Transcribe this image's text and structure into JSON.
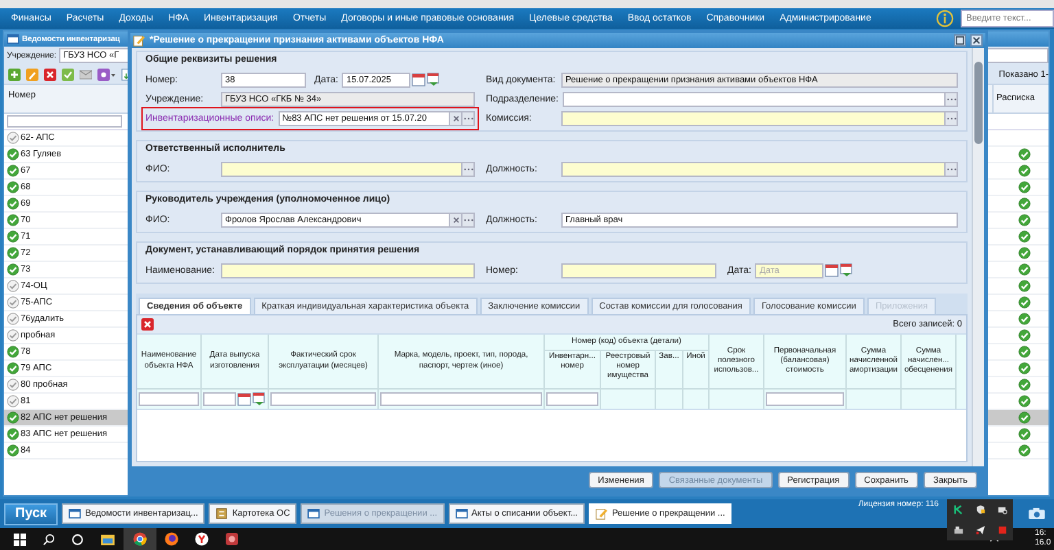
{
  "menu": [
    "Финансы",
    "Расчеты",
    "Доходы",
    "НФА",
    "Инвентаризация",
    "Отчеты",
    "Договоры и иные правовые основания",
    "Целевые средства",
    "Ввод остатков",
    "Справочники",
    "Администрирование"
  ],
  "search": {
    "placeholder": "Введите текст..."
  },
  "list_window": {
    "title": "Ведомости инвентаризац",
    "institution": {
      "label": "Учреждение:",
      "value": "ГБУЗ НСО «Г"
    },
    "shown": "Показано 1-",
    "columns": [
      "Номер",
      "Расписка"
    ],
    "rows": [
      {
        "number": "62- АПС",
        "done": false,
        "receipt": false,
        "selected": false
      },
      {
        "number": "63 Гуляев",
        "done": true,
        "receipt": true,
        "selected": false
      },
      {
        "number": "67",
        "done": true,
        "receipt": true,
        "selected": false
      },
      {
        "number": "68",
        "done": true,
        "receipt": true,
        "selected": false
      },
      {
        "number": "69",
        "done": true,
        "receipt": true,
        "selected": false
      },
      {
        "number": "70",
        "done": true,
        "receipt": true,
        "selected": false
      },
      {
        "number": "71",
        "done": true,
        "receipt": true,
        "selected": false
      },
      {
        "number": "72",
        "done": true,
        "receipt": true,
        "selected": false
      },
      {
        "number": "73",
        "done": true,
        "receipt": true,
        "selected": false
      },
      {
        "number": "74-ОЦ",
        "done": false,
        "receipt": true,
        "selected": false
      },
      {
        "number": "75-АПС",
        "done": false,
        "receipt": true,
        "selected": false
      },
      {
        "number": "76удалить",
        "done": false,
        "receipt": true,
        "selected": false
      },
      {
        "number": "пробная",
        "done": false,
        "receipt": true,
        "selected": false
      },
      {
        "number": "78",
        "done": true,
        "receipt": true,
        "selected": false
      },
      {
        "number": "79 АПС",
        "done": true,
        "receipt": true,
        "selected": false
      },
      {
        "number": "80 пробная",
        "done": false,
        "receipt": true,
        "selected": false
      },
      {
        "number": "81",
        "done": false,
        "receipt": true,
        "selected": false
      },
      {
        "number": "82 АПС нет решения",
        "done": true,
        "receipt": true,
        "selected": true
      },
      {
        "number": "83 АПС нет решения",
        "done": true,
        "receipt": true,
        "selected": false
      },
      {
        "number": "84",
        "done": true,
        "receipt": true,
        "selected": false
      }
    ]
  },
  "dialog": {
    "title": "*Решение о прекращении признания активами объектов НФА",
    "sections": [
      {
        "title": "Общие реквизиты решения",
        "rows": [
          {
            "left": [
              {
                "label": "Номер:",
                "value": "38",
                "kind": "text"
              },
              {
                "label": "Дата:",
                "value": "15.07.2025",
                "kind": "text",
                "calendar": true
              }
            ],
            "right": [
              {
                "label": "Вид документа:",
                "value": "Решение о прекращении признания активами объектов НФА",
                "kind": "readonly"
              }
            ]
          },
          {
            "left": [
              {
                "label": "Учреждение:",
                "value": "ГБУЗ НСО «ГКБ № 34»",
                "kind": "readonly"
              }
            ],
            "right": [
              {
                "label": "Подразделение:",
                "kind": "text",
                "picker": true
              }
            ]
          },
          {
            "left": [
              {
                "label": "Инвентаризационные описи:",
                "value": "№83 АПС нет решения от 15.07.20",
                "kind": "text",
                "clear": true,
                "picker": true,
                "link": true,
                "highlight": true
              }
            ],
            "right": [
              {
                "label": "Комиссия:",
                "kind": "required",
                "picker": true
              }
            ]
          }
        ]
      },
      {
        "title": "Ответственный исполнитель",
        "rows": [
          {
            "left": [
              {
                "label": "ФИО:",
                "kind": "required",
                "picker": true
              }
            ],
            "right": [
              {
                "label": "Должность:",
                "kind": "required",
                "picker": true
              }
            ]
          }
        ]
      },
      {
        "title": "Руководитель учреждения (уполномоченное лицо)",
        "rows": [
          {
            "left": [
              {
                "label": "ФИО:",
                "value": "Фролов Ярослав Александрович",
                "kind": "text",
                "clear": true,
                "picker": true
              }
            ],
            "right": [
              {
                "label": "Должность:",
                "value": "Главный врач",
                "kind": "text"
              }
            ]
          }
        ]
      },
      {
        "title": "Документ, устанавливающий порядок принятия решения",
        "rows": [
          {
            "left": [
              {
                "label": "Наименование:",
                "kind": "required"
              }
            ],
            "right": [
              {
                "label": "Номер:",
                "kind": "required"
              },
              {
                "label": "Дата:",
                "placeholder": "Дата",
                "kind": "required",
                "calendar": true
              }
            ]
          }
        ]
      }
    ],
    "tabs": [
      {
        "label": "Сведения об объекте",
        "selected": true,
        "disabled": false
      },
      {
        "label": "Краткая индивидуальная характеристика объекта",
        "selected": false,
        "disabled": false
      },
      {
        "label": "Заключение комиссии",
        "selected": false,
        "disabled": false
      },
      {
        "label": "Состав комиссии для голосования",
        "selected": false,
        "disabled": false
      },
      {
        "label": "Голосование комиссии",
        "selected": false,
        "disabled": false
      },
      {
        "label": "Приложения",
        "selected": false,
        "disabled": true
      }
    ],
    "grid": {
      "total": "Всего записей: 0",
      "columns": [
        {
          "label": "Наименование объекта НФА",
          "filter": true
        },
        {
          "label": "Дата выпуска изготовления",
          "filter": true,
          "kind": "date"
        },
        {
          "label": "Фактический срок эксплуатации (месяцев)",
          "filter": true
        },
        {
          "label": "Марка, модель, проект, тип, порода, паспорт, чертеж (иное)",
          "filter": true
        },
        {
          "group": "Номер (код) объекта (детали)",
          "children": [
            {
              "label": "Инвентарн... номер",
              "filter": true
            },
            {
              "label": "Реестровый номер имущества"
            },
            {
              "label": "Зав..."
            },
            {
              "label": "Иной"
            }
          ]
        },
        {
          "label": "Срок полезного использов..."
        },
        {
          "label": "Первоначальная (балансовая) стоимость",
          "filter": true
        },
        {
          "label": "Сумма начисленной амортизации"
        },
        {
          "label": "Сумма начислен... обесценения"
        }
      ]
    },
    "buttons": [
      {
        "label": "Изменения",
        "disabled": false
      },
      {
        "label": "Связанные документы",
        "disabled": true
      },
      {
        "label": "Регистрация",
        "disabled": false
      },
      {
        "label": "Сохранить",
        "disabled": false
      },
      {
        "label": "Закрыть",
        "disabled": false
      }
    ]
  },
  "taskbar": {
    "start": "Пуск",
    "license": "Лицензия номер: 116",
    "windows": [
      {
        "title": "Ведомости инвентаризац...",
        "kind": "window",
        "faded": false,
        "selected": false
      },
      {
        "title": "Картотека ОС",
        "kind": "cabinet",
        "faded": false,
        "selected": false
      },
      {
        "title": "Решения о прекращении ...",
        "kind": "window",
        "faded": true,
        "selected": false
      },
      {
        "title": "Акты о списании объект...",
        "kind": "window",
        "faded": false,
        "selected": false
      },
      {
        "title": "Решение о прекращении ...",
        "kind": "note",
        "faded": false,
        "selected": true
      }
    ]
  },
  "clock": [
    "16:",
    "16.0"
  ]
}
